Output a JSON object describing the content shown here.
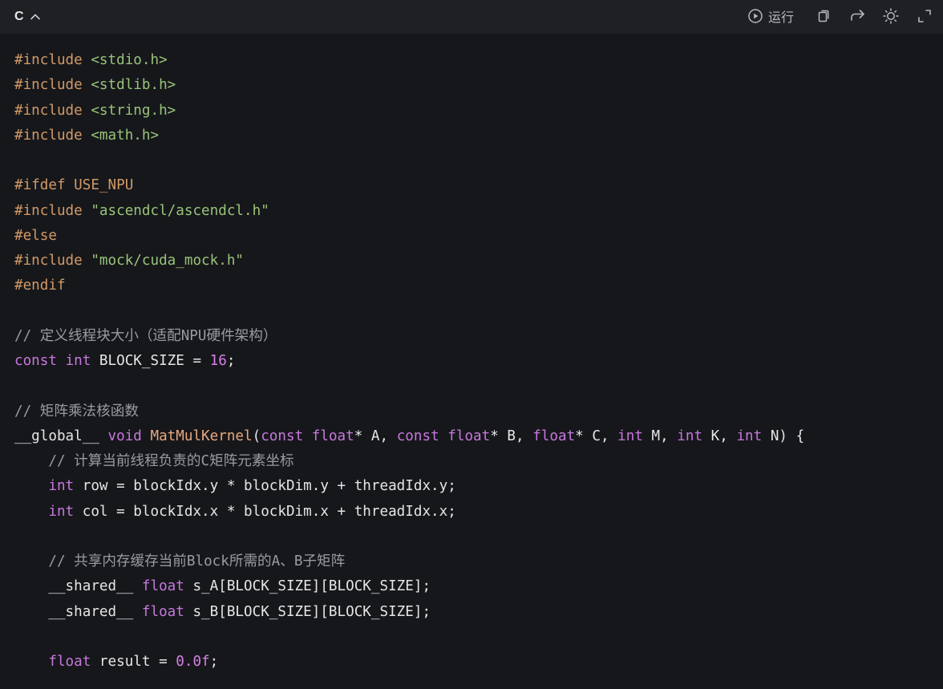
{
  "header": {
    "language": "C",
    "run_label": "运行",
    "icons": [
      "chevron-up-icon",
      "play-circle-icon",
      "copy-icon",
      "share-arrow-icon",
      "theme-sun-icon",
      "expand-icon"
    ]
  },
  "colors": {
    "background": "#16171b",
    "header_bg": "#1f2024",
    "preprocessor": "#d19a66",
    "string": "#98c379",
    "keyword": "#c678dd",
    "number": "#d87ee8",
    "function": "#e8a87c",
    "comment": "#9a9ba1",
    "text": "#e6e6e6"
  },
  "code": [
    [
      [
        "p",
        "#include"
      ],
      [
        "t",
        " "
      ],
      [
        "s",
        "<stdio.h>"
      ]
    ],
    [
      [
        "p",
        "#include"
      ],
      [
        "t",
        " "
      ],
      [
        "s",
        "<stdlib.h>"
      ]
    ],
    [
      [
        "p",
        "#include"
      ],
      [
        "t",
        " "
      ],
      [
        "s",
        "<string.h>"
      ]
    ],
    [
      [
        "p",
        "#include"
      ],
      [
        "t",
        " "
      ],
      [
        "s",
        "<math.h>"
      ]
    ],
    [],
    [
      [
        "p",
        "#ifdef USE_NPU"
      ]
    ],
    [
      [
        "p",
        "#include"
      ],
      [
        "t",
        " "
      ],
      [
        "s",
        "\"ascendcl/ascendcl.h\""
      ]
    ],
    [
      [
        "p",
        "#else"
      ]
    ],
    [
      [
        "p",
        "#include"
      ],
      [
        "t",
        " "
      ],
      [
        "s",
        "\"mock/cuda_mock.h\""
      ]
    ],
    [
      [
        "p",
        "#endif"
      ]
    ],
    [],
    [
      [
        "c",
        "// 定义线程块大小（适配NPU硬件架构）"
      ]
    ],
    [
      [
        "k",
        "const"
      ],
      [
        "t",
        " "
      ],
      [
        "k",
        "int"
      ],
      [
        "t",
        " BLOCK_SIZE = "
      ],
      [
        "n",
        "16"
      ],
      [
        "t",
        ";"
      ]
    ],
    [],
    [
      [
        "c",
        "// 矩阵乘法核函数"
      ]
    ],
    [
      [
        "t",
        "__global__ "
      ],
      [
        "k",
        "void"
      ],
      [
        "t",
        " "
      ],
      [
        "fn",
        "MatMulKernel"
      ],
      [
        "t",
        "("
      ],
      [
        "k",
        "const"
      ],
      [
        "t",
        " "
      ],
      [
        "k",
        "float"
      ],
      [
        "t",
        "* A, "
      ],
      [
        "k",
        "const"
      ],
      [
        "t",
        " "
      ],
      [
        "k",
        "float"
      ],
      [
        "t",
        "* B, "
      ],
      [
        "k",
        "float"
      ],
      [
        "t",
        "* C, "
      ],
      [
        "k",
        "int"
      ],
      [
        "t",
        " M, "
      ],
      [
        "k",
        "int"
      ],
      [
        "t",
        " K, "
      ],
      [
        "k",
        "int"
      ],
      [
        "t",
        " N) {"
      ]
    ],
    [
      [
        "t",
        "    "
      ],
      [
        "c",
        "// 计算当前线程负责的C矩阵元素坐标"
      ]
    ],
    [
      [
        "t",
        "    "
      ],
      [
        "k",
        "int"
      ],
      [
        "t",
        " row = blockIdx.y * blockDim.y + threadIdx.y;"
      ]
    ],
    [
      [
        "t",
        "    "
      ],
      [
        "k",
        "int"
      ],
      [
        "t",
        " col = blockIdx.x * blockDim.x + threadIdx.x;"
      ]
    ],
    [],
    [
      [
        "t",
        "    "
      ],
      [
        "c",
        "// 共享内存缓存当前Block所需的A、B子矩阵"
      ]
    ],
    [
      [
        "t",
        "    __shared__ "
      ],
      [
        "k",
        "float"
      ],
      [
        "t",
        " s_A[BLOCK_SIZE][BLOCK_SIZE];"
      ]
    ],
    [
      [
        "t",
        "    __shared__ "
      ],
      [
        "k",
        "float"
      ],
      [
        "t",
        " s_B[BLOCK_SIZE][BLOCK_SIZE];"
      ]
    ],
    [],
    [
      [
        "t",
        "    "
      ],
      [
        "k",
        "float"
      ],
      [
        "t",
        " result = "
      ],
      [
        "n",
        "0.0f"
      ],
      [
        "t",
        ";"
      ]
    ]
  ]
}
